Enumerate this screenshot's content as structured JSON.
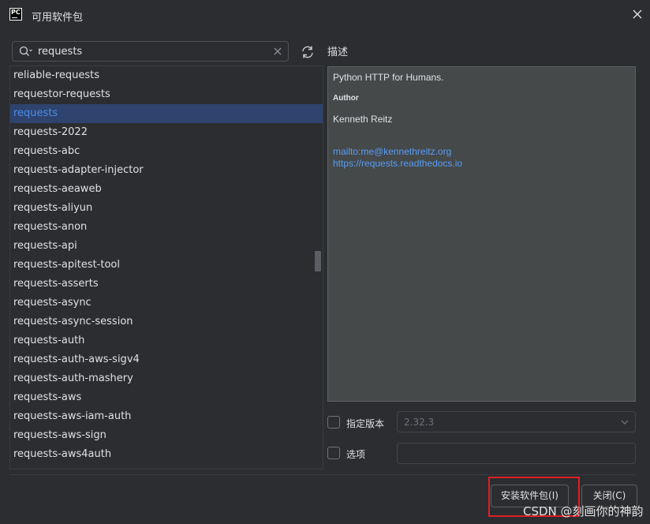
{
  "window": {
    "title": "可用软件包"
  },
  "search": {
    "value": "requests",
    "placeholder": ""
  },
  "packages": [
    "reliable-requests",
    "requestor-requests",
    "requests",
    "requests-2022",
    "requests-abc",
    "requests-adapter-injector",
    "requests-aeaweb",
    "requests-aliyun",
    "requests-anon",
    "requests-api",
    "requests-apitest-tool",
    "requests-asserts",
    "requests-async",
    "requests-async-session",
    "requests-auth",
    "requests-auth-aws-sigv4",
    "requests-auth-mashery",
    "requests-aws",
    "requests-aws-iam-auth",
    "requests-aws-sign",
    "requests-aws4auth"
  ],
  "selected_package": "requests",
  "description": {
    "label": "描述",
    "summary": "Python HTTP for Humans.",
    "author_label": "Author",
    "author": "Kenneth Reitz",
    "email_link": "mailto:me@kennethreitz.org",
    "url_link": "https://requests.readthedocs.io"
  },
  "options": {
    "specify_version_label": "指定版本",
    "specify_version_checked": false,
    "version_value": "2.32.3",
    "options_label": "选项",
    "options_checked": false,
    "options_value": ""
  },
  "buttons": {
    "install": "安装软件包(I)",
    "close": "关闭(C)"
  },
  "watermark": "CSDN @刻画你的神韵",
  "icons": {
    "logo": "pycharm-logo-icon",
    "close": "close-icon",
    "search": "search-icon",
    "clear": "clear-icon",
    "refresh": "refresh-icon",
    "chevron": "chevron-down-icon"
  },
  "colors": {
    "background": "#2b2d30",
    "selection": "#2e436e",
    "selection_text": "#4d8ce7",
    "link": "#589df6",
    "highlight_box": "#e01e24"
  }
}
